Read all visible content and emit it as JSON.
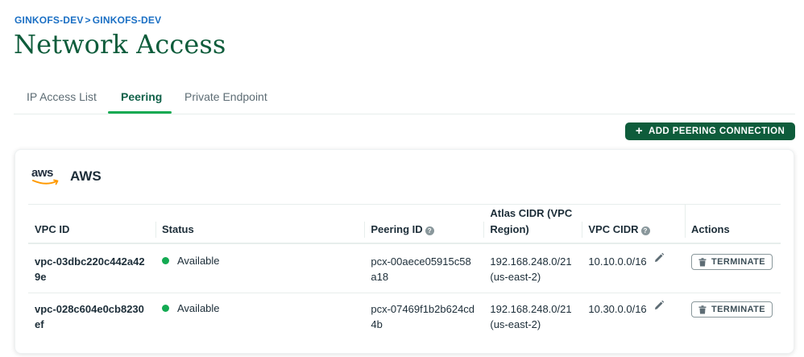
{
  "breadcrumb": {
    "org": "GINKOFS-DEV",
    "separator": ">",
    "project": "GINKOFS-DEV"
  },
  "page": {
    "title": "Network Access"
  },
  "tabs": [
    {
      "label": "IP Access List",
      "active": false
    },
    {
      "label": "Peering",
      "active": true
    },
    {
      "label": "Private Endpoint",
      "active": false
    }
  ],
  "actions": {
    "add_peering_label": "ADD PEERING CONNECTION",
    "add_icon": "plus-icon"
  },
  "provider": {
    "logo_text": "aws",
    "name": "AWS"
  },
  "table": {
    "headers": {
      "vpc_id": "VPC ID",
      "status": "Status",
      "peering_id": "Peering ID",
      "atlas_cidr": "Atlas CIDR (VPC Region)",
      "vpc_cidr": "VPC CIDR",
      "actions": "Actions"
    },
    "rows": [
      {
        "vpc_id": "vpc-03dbc220c442a429e",
        "status": "Available",
        "peering_id": "pcx-00aece05915c58a18",
        "atlas_cidr": "192.168.248.0/21 (us-east-2)",
        "vpc_cidr": "10.10.0.0/16",
        "action_label": "TERMINATE"
      },
      {
        "vpc_id": "vpc-028c604e0cb8230ef",
        "status": "Available",
        "peering_id": "pcx-07469f1b2b624cd4b",
        "atlas_cidr": "192.168.248.0/21 (us-east-2)",
        "vpc_cidr": "10.30.0.0/16",
        "action_label": "TERMINATE"
      }
    ]
  },
  "colors": {
    "brand_green": "#0e5c3b",
    "accent_green": "#13aa52",
    "link_blue": "#1a6fc4"
  }
}
